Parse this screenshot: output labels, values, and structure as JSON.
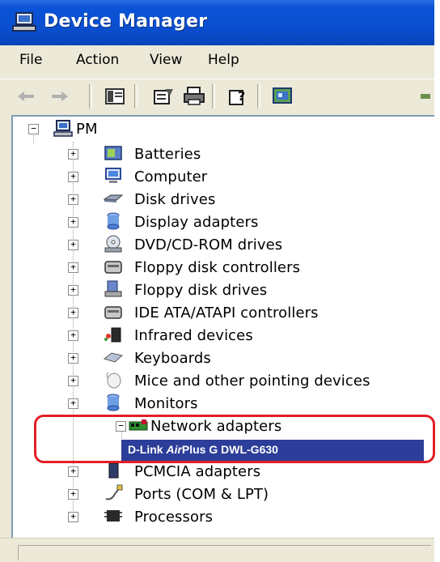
{
  "window": {
    "title": "Device Manager"
  },
  "menu": {
    "items": [
      "File",
      "Action",
      "View",
      "Help"
    ]
  },
  "toolbar": {
    "buttons": [
      "back-arrow-icon",
      "forward-arrow-icon",
      "show-hide-console-tree-icon",
      "properties-icon",
      "print-icon",
      "help-icon",
      "scan-hardware-icon",
      "more-icon"
    ]
  },
  "tree": {
    "root": {
      "label": "PM",
      "icon": "computer-icon"
    },
    "categories": [
      {
        "label": "Batteries",
        "icon": "battery-icon"
      },
      {
        "label": "Computer",
        "icon": "computer-icon"
      },
      {
        "label": "Disk drives",
        "icon": "disk-drive-icon"
      },
      {
        "label": "Display adapters",
        "icon": "display-adapter-icon"
      },
      {
        "label": "DVD/CD-ROM drives",
        "icon": "cdrom-icon"
      },
      {
        "label": "Floppy disk controllers",
        "icon": "controller-icon"
      },
      {
        "label": "Floppy disk drives",
        "icon": "floppy-icon"
      },
      {
        "label": "IDE ATA/ATAPI controllers",
        "icon": "controller-icon"
      },
      {
        "label": "Infrared devices",
        "icon": "infrared-icon"
      },
      {
        "label": "Keyboards",
        "icon": "keyboard-icon"
      },
      {
        "label": "Mice and other pointing devices",
        "icon": "mouse-icon"
      },
      {
        "label": "Monitors",
        "icon": "monitor-icon"
      },
      {
        "label": "Network adapters",
        "icon": "network-adapter-icon"
      },
      {
        "label": "PCMCIA adapters",
        "icon": "pcmcia-icon"
      },
      {
        "label": "Ports (COM & LPT)",
        "icon": "port-icon"
      },
      {
        "label": "Processors",
        "icon": "processor-icon"
      }
    ],
    "selected_child": {
      "prefix": "D-Link ",
      "italic": "Air",
      "suffix": "Plus  G DWL-G630"
    }
  },
  "colors": {
    "titlebar": "#0a52d6",
    "selection": "#2c3e99",
    "highlight": "#e41e26"
  }
}
